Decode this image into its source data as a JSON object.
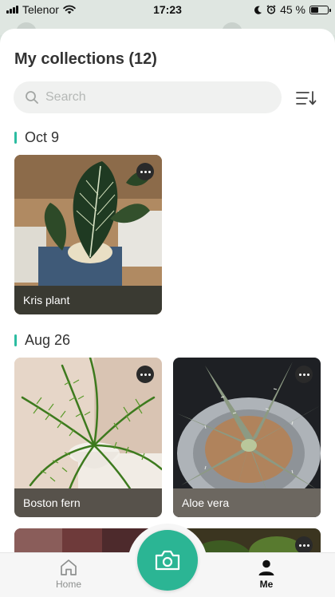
{
  "status_bar": {
    "carrier": "Telenor",
    "time": "17:23",
    "battery_percent": "45 %",
    "battery_level": 0.45,
    "icons": [
      "signal-icon",
      "wifi-icon",
      "moon-icon",
      "alarm-icon",
      "battery-icon"
    ]
  },
  "header": {
    "title": "My collections (12)"
  },
  "search": {
    "placeholder": "Search",
    "value": ""
  },
  "sort": {
    "icon": "sort-icon"
  },
  "sections": [
    {
      "date": "Oct 9",
      "items": [
        {
          "name": "Kris plant",
          "more_icon": "more-icon"
        }
      ]
    },
    {
      "date": "Aug 26",
      "items": [
        {
          "name": "Boston fern",
          "more_icon": "more-icon"
        },
        {
          "name": "Aloe vera",
          "more_icon": "more-icon"
        }
      ]
    }
  ],
  "tab_bar": {
    "home_label": "Home",
    "me_label": "Me",
    "camera_icon": "camera-icon",
    "active_tab": "Me"
  },
  "colors": {
    "accent": "#2bb594",
    "section_marker": "#2cbca1",
    "label_overlay": "#3a3a32"
  }
}
